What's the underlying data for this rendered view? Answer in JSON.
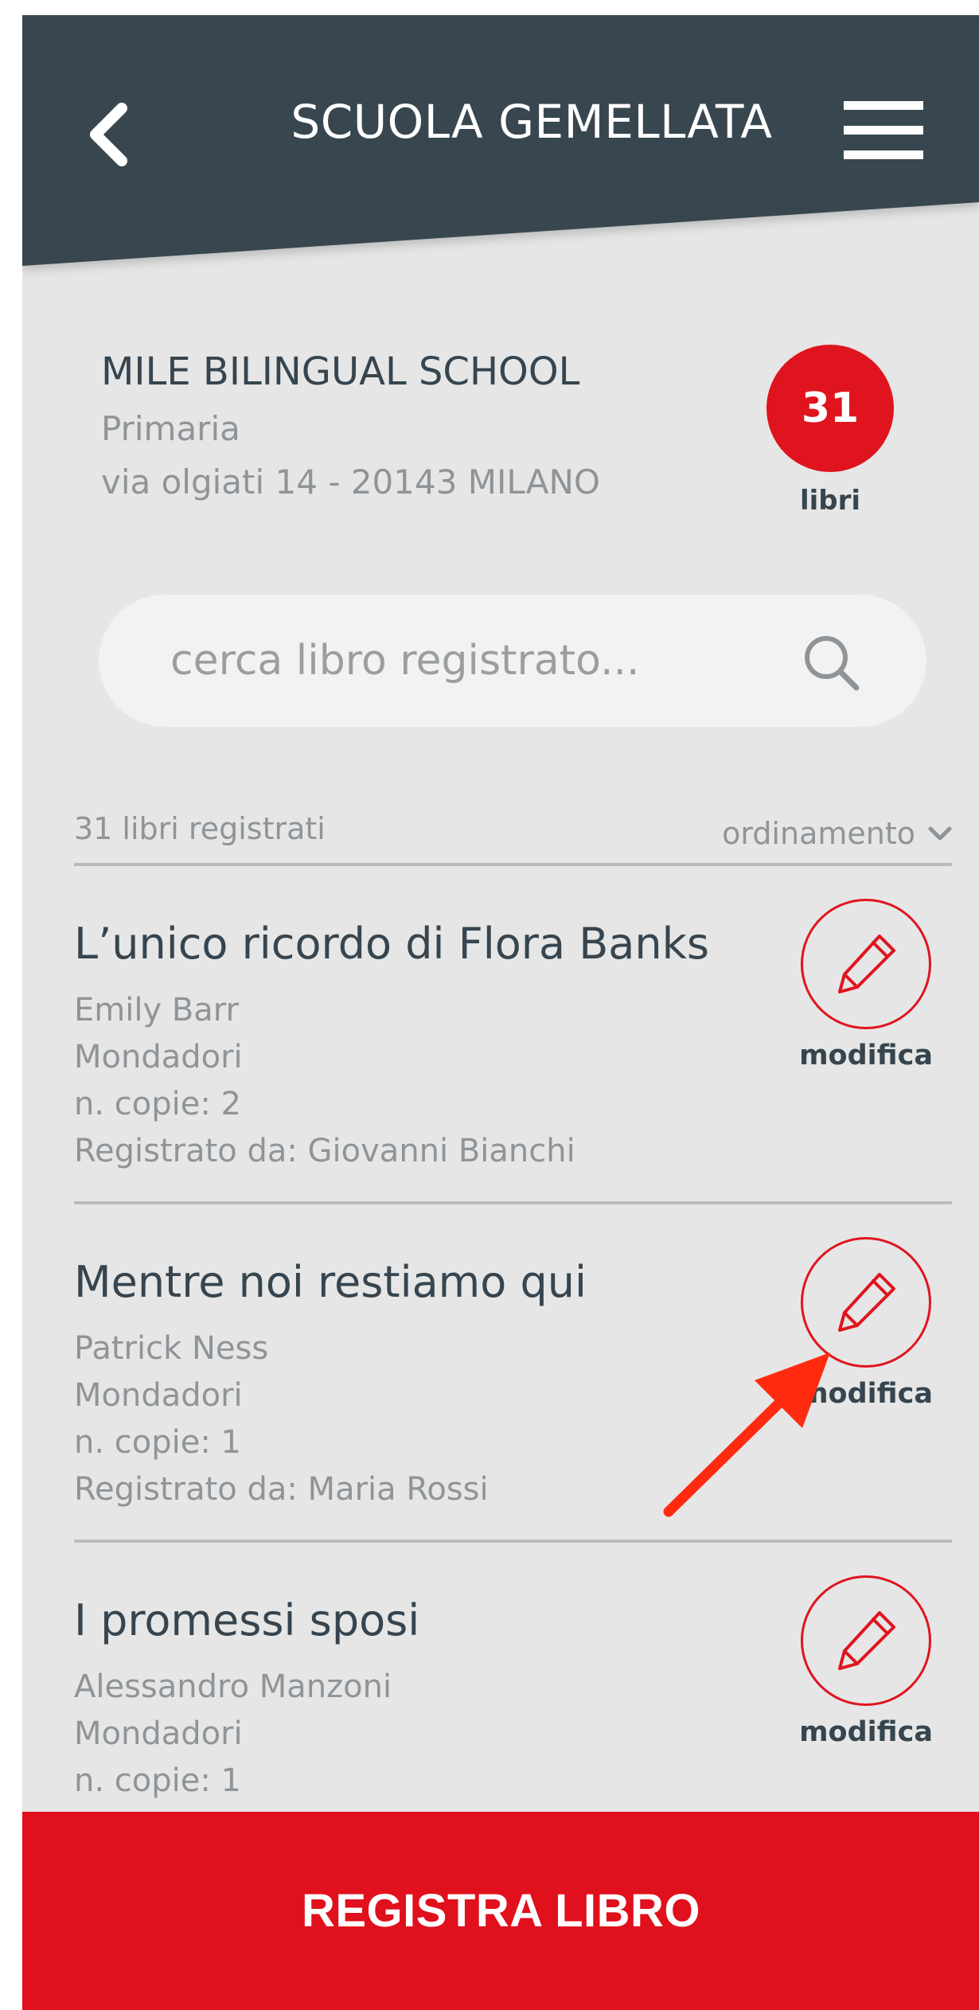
{
  "header": {
    "title": "SCUOLA GEMELLATA",
    "back_icon": "chevron-left-icon",
    "menu_icon": "hamburger-menu-icon",
    "color": "#37464f"
  },
  "school": {
    "name": "MILE BILINGUAL SCHOOL",
    "type": "Primaria",
    "address": "via olgiati 14 - 20143 MILANO",
    "book_count": "31",
    "book_count_label": "libri"
  },
  "search": {
    "placeholder": "cerca libro registrato...",
    "value": "",
    "icon": "search-icon"
  },
  "list": {
    "count_text": "31 libri registrati",
    "sort_label": "ordinamento",
    "sort_icon": "chevron-down-icon"
  },
  "books": [
    {
      "title": "L’unico ricordo di Flora Banks",
      "author": "Emily Barr",
      "publisher": "Mondadori",
      "copies": "n. copie: 2",
      "registered_by": "Registrato da: Giovanni Bianchi",
      "edit_label": "modifica"
    },
    {
      "title": "Mentre noi restiamo qui",
      "author": "Patrick Ness",
      "publisher": "Mondadori",
      "copies": "n. copie: 1",
      "registered_by": "Registrato da: Maria Rossi",
      "edit_label": "modifica"
    },
    {
      "title": "I promessi sposi",
      "author": "Alessandro Manzoni",
      "publisher": "Mondadori",
      "copies": "n. copie: 1",
      "registered_by": "",
      "edit_label": "modifica"
    }
  ],
  "footer": {
    "register_label": "REGISTRA LIBRO",
    "color": "#e0101c"
  },
  "colors": {
    "accent_red": "#e0141e",
    "annotation_red": "#ff2a10",
    "background": "#e6e6e6",
    "text_dark": "#36454f",
    "text_muted": "#8f9498"
  }
}
